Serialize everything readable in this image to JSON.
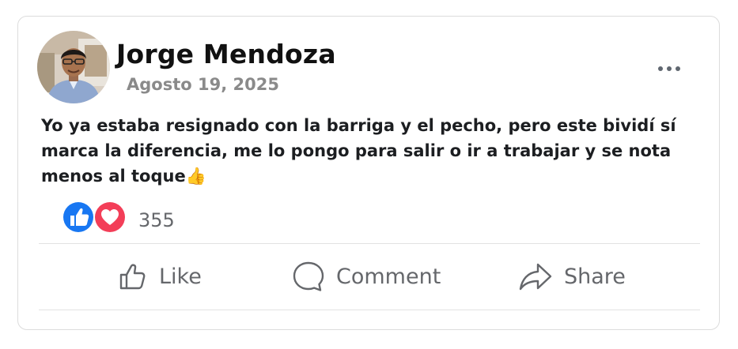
{
  "post": {
    "author_name": "Jorge Mendoza",
    "date": "Agosto 19, 2025",
    "body_text": "Yo ya estaba resignado con la barriga y el pecho, pero este bividí sí marca la diferencia, me lo pongo para salir o ir a trabajar y se nota menos al toque👍",
    "avatar_icon": "person-photo-icon",
    "more_icon": "ellipsis-icon"
  },
  "reactions": {
    "types": [
      "like-reaction-icon",
      "love-reaction-icon"
    ],
    "count": "355",
    "like_color": "#1877f2",
    "love_color": "#f33e58"
  },
  "actions": {
    "like_label": "Like",
    "comment_label": "Comment",
    "share_label": "Share",
    "icon_color": "#65676b"
  }
}
